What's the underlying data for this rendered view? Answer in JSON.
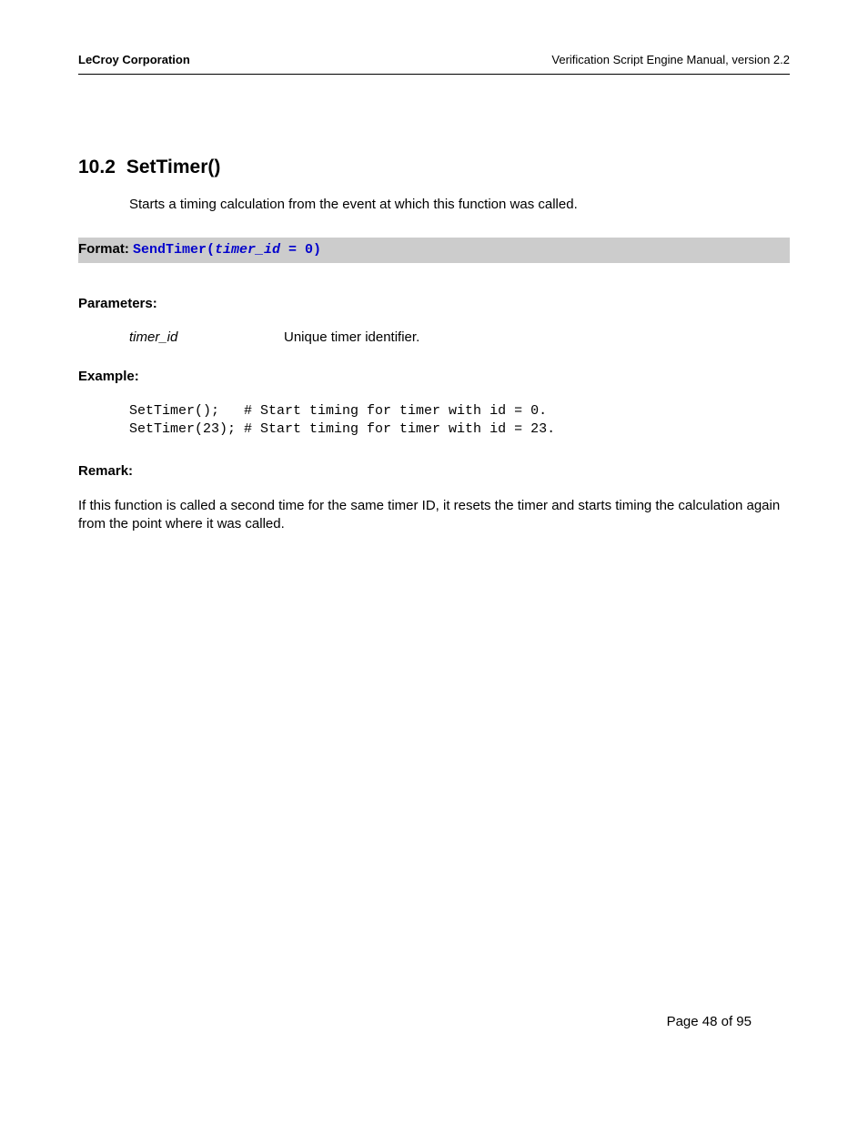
{
  "header": {
    "left": "LeCroy Corporation",
    "right": "Verification Script Engine Manual, version 2.2"
  },
  "section": {
    "number": "10.2",
    "title": "SetTimer()",
    "intro": "Starts a timing calculation from the event at which this function was called."
  },
  "format": {
    "label": "Format: ",
    "func_open": "SendTimer(",
    "param": "timer_id",
    "rest": " = 0)"
  },
  "parameters": {
    "heading": "Parameters:",
    "items": [
      {
        "name": "timer_id",
        "desc": "Unique timer identifier."
      }
    ]
  },
  "example": {
    "heading": "Example:",
    "code": "SetTimer();   # Start timing for timer with id = 0.\nSetTimer(23); # Start timing for timer with id = 23."
  },
  "remark": {
    "heading": "Remark:",
    "text": "If this function is called a second time for the same timer ID, it resets the timer and starts timing the calculation again from the point where it was called."
  },
  "footer": {
    "text": "Page 48 of 95"
  }
}
